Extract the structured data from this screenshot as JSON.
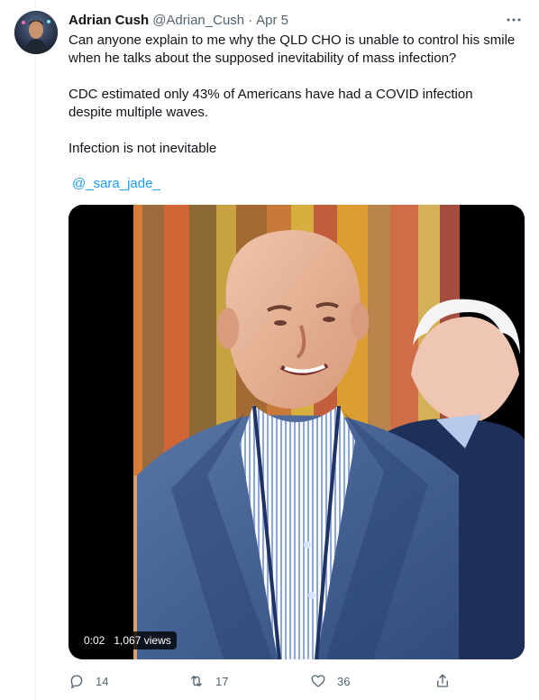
{
  "tweet": {
    "author_name": "Adrian Cush",
    "author_handle": "@Adrian_Cush",
    "separator": "·",
    "date": "Apr 5",
    "paragraphs": [
      "Can anyone explain to me why the QLD CHO is unable to control his smile when he talks about the supposed inevitability of mass infection?",
      "CDC estimated only 43% of Americans have had a COVID infection despite multiple waves.",
      "Infection is not inevitable"
    ],
    "mention": "@_sara_jade_"
  },
  "video": {
    "time": "0:02",
    "views": "1,067 views"
  },
  "actions": {
    "replies": "14",
    "retweets": "17",
    "likes": "36"
  },
  "icons": {
    "more": "more-horizontal-icon",
    "reply": "reply-icon",
    "retweet": "retweet-icon",
    "like": "heart-icon",
    "share": "share-icon"
  },
  "colors": {
    "text": "#0f1419",
    "secondary": "#536471",
    "link": "#1d9bf0"
  }
}
